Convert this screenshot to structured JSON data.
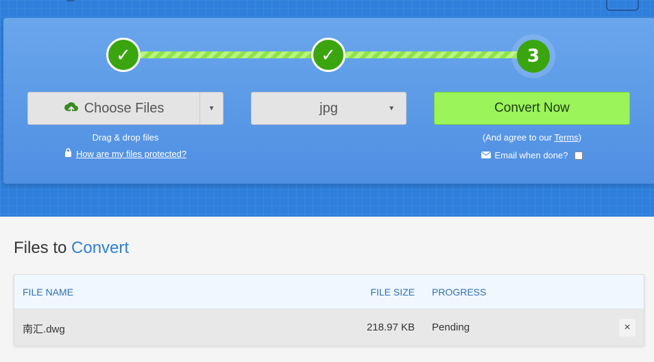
{
  "steps": {
    "step1_mark": "✓",
    "step2_mark": "✓",
    "step3_label": "3"
  },
  "choose_files": {
    "label": "Choose Files",
    "drag_text": "Drag & drop files",
    "protected_link": "How are my files protected?"
  },
  "format": {
    "selected": "jpg"
  },
  "convert": {
    "label": "Convert Now",
    "agree_prefix": "(And agree to our ",
    "terms_link": "Terms",
    "agree_suffix": ")",
    "email_label": "Email when done?"
  },
  "files": {
    "title_prefix": "Files to",
    "title_accent": "Convert",
    "columns": {
      "name": "FILE NAME",
      "size": "FILE SIZE",
      "progress": "PROGRESS"
    },
    "rows": [
      {
        "name": "南汇.dwg",
        "size": "218.97 KB",
        "progress": "Pending",
        "remove": "×"
      }
    ]
  },
  "colors": {
    "hero_blue": "#2f7fdc",
    "panel_blue": "#5a98e6",
    "step_green": "#3aa50f",
    "convert_green": "#9bf45a",
    "accent_blue": "#2f80d0"
  }
}
